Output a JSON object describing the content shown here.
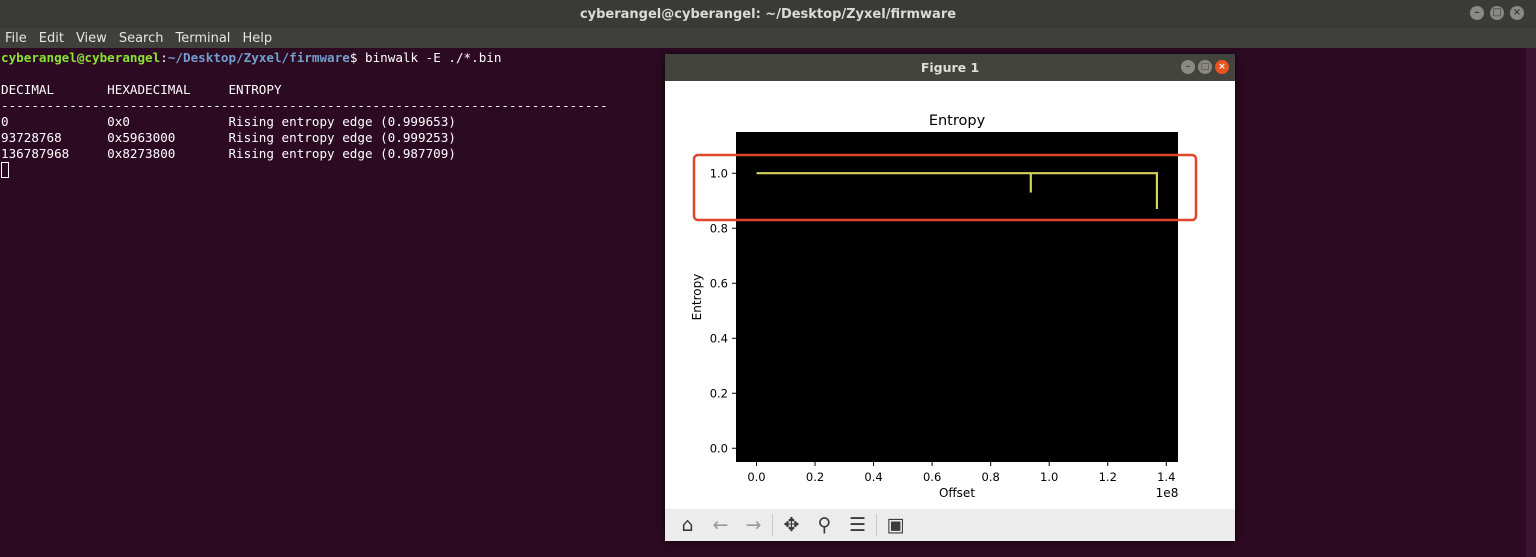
{
  "window": {
    "title": "cyberangel@cyberangel: ~/Desktop/Zyxel/firmware",
    "buttons": [
      "–",
      "□",
      "×"
    ]
  },
  "menu": [
    "File",
    "Edit",
    "View",
    "Search",
    "Terminal",
    "Help"
  ],
  "terminal": {
    "prompt_user": "cyberangel@cyberangel",
    "prompt_sep": ":",
    "prompt_path": "~/Desktop/Zyxel/firmware",
    "prompt_end": "$ ",
    "command": "binwalk -E ./*.bin",
    "header": "DECIMAL       HEXADECIMAL     ENTROPY",
    "divider": "--------------------------------------------------------------------------------",
    "rows": [
      "0             0x0             Rising entropy edge (0.999653)",
      "93728768      0x5963000       Rising entropy edge (0.999253)",
      "136787968     0x8273800       Rising entropy edge (0.987709)"
    ]
  },
  "figure": {
    "title": "Figure 1",
    "buttons": [
      "–",
      "□",
      "×"
    ],
    "highlight_color": "#e0442a",
    "toolbar": [
      {
        "name": "home-icon",
        "glyph": "⌂",
        "dim": false
      },
      {
        "name": "back-icon",
        "glyph": "←",
        "dim": true
      },
      {
        "name": "forward-icon",
        "glyph": "→",
        "dim": true
      },
      {
        "name": "pan-icon",
        "glyph": "✥",
        "dim": false
      },
      {
        "name": "zoom-icon",
        "glyph": "⚲",
        "dim": false
      },
      {
        "name": "configure-icon",
        "glyph": "☰",
        "dim": false
      },
      {
        "name": "save-icon",
        "glyph": "▣",
        "dim": false
      }
    ]
  },
  "chart_data": {
    "type": "line",
    "title": "Entropy",
    "xlabel": "Offset",
    "ylabel": "Entropy",
    "x_offset_text": "1e8",
    "xlim": [
      -0.07,
      1.44
    ],
    "ylim": [
      -0.05,
      1.15
    ],
    "xticks": [
      0.0,
      0.2,
      0.4,
      0.6,
      0.8,
      1.0,
      1.2,
      1.4
    ],
    "xtick_labels": [
      "0.0",
      "0.2",
      "0.4",
      "0.6",
      "0.8",
      "1.0",
      "1.2",
      "1.4"
    ],
    "yticks": [
      0.0,
      0.2,
      0.4,
      0.6,
      0.8,
      1.0
    ],
    "ytick_labels": [
      "0.0",
      "0.2",
      "0.4",
      "0.6",
      "0.8",
      "1.0"
    ],
    "background": "#000000",
    "line_color": "#d4d45a",
    "series": [
      {
        "x": [
          0.0,
          0.937,
          0.937,
          0.937,
          0.937,
          1.368,
          1.368,
          1.368
        ],
        "y": [
          1.0,
          1.0,
          0.93,
          1.0,
          1.0,
          1.0,
          0.87,
          0.87
        ]
      }
    ]
  }
}
